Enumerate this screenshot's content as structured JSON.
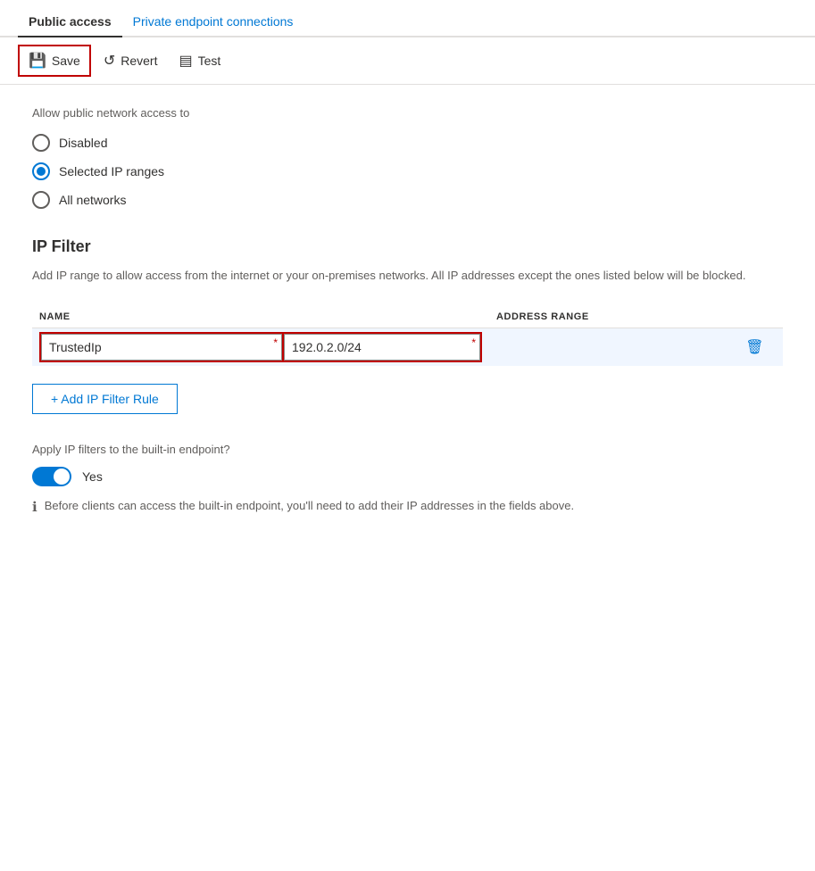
{
  "tabs": [
    {
      "id": "public-access",
      "label": "Public access",
      "active": true
    },
    {
      "id": "private-endpoint",
      "label": "Private endpoint connections",
      "active": false
    }
  ],
  "toolbar": {
    "save_label": "Save",
    "revert_label": "Revert",
    "test_label": "Test"
  },
  "network_access": {
    "section_label": "Allow public network access to",
    "options": [
      {
        "id": "disabled",
        "label": "Disabled",
        "selected": false
      },
      {
        "id": "selected-ip",
        "label": "Selected IP ranges",
        "selected": true
      },
      {
        "id": "all-networks",
        "label": "All networks",
        "selected": false
      }
    ]
  },
  "ip_filter": {
    "title": "IP Filter",
    "description": "Add IP range to allow access from the internet or your on-premises networks. All IP addresses except the ones listed below will be blocked.",
    "table": {
      "columns": [
        {
          "id": "name",
          "label": "NAME"
        },
        {
          "id": "address_range",
          "label": "ADDRESS RANGE"
        }
      ],
      "rows": [
        {
          "name_value": "TrustedIp",
          "name_placeholder": "",
          "address_value": "192.0.2.0/24",
          "address_placeholder": ""
        }
      ]
    },
    "add_rule_label": "+ Add IP Filter Rule"
  },
  "built_in_endpoint": {
    "label": "Apply IP filters to the built-in endpoint?",
    "toggle_on": true,
    "toggle_label": "Yes",
    "note": "Before clients can access the built-in endpoint, you'll need to add their IP addresses in the fields above."
  },
  "icons": {
    "save": "💾",
    "revert": "↺",
    "test": "⬛",
    "delete": "🗑",
    "plus": "+",
    "info": "ℹ"
  }
}
